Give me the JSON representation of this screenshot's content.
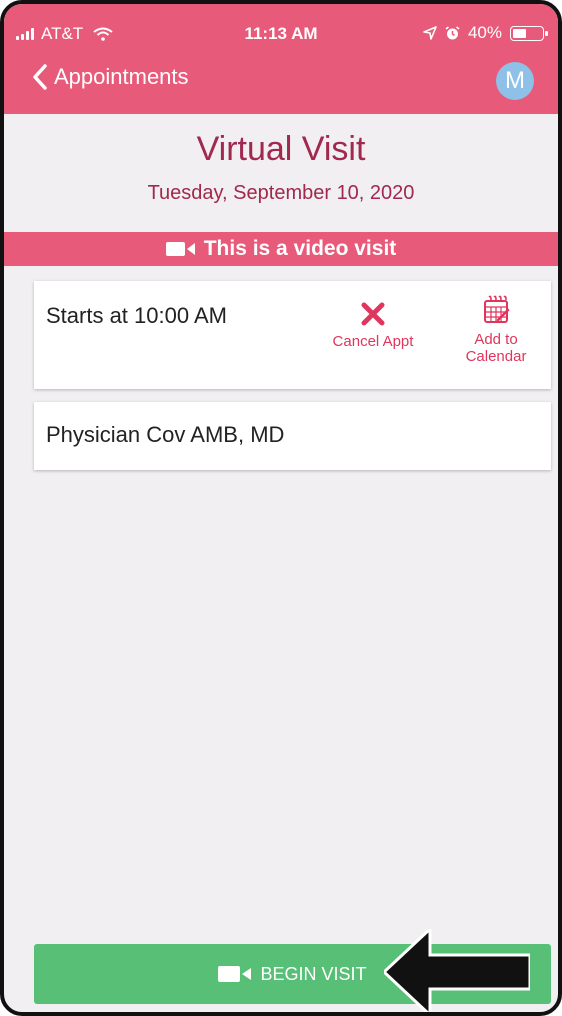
{
  "status_bar": {
    "carrier": "AT&T",
    "time": "11:13 AM",
    "battery": "40%",
    "battery_level": 0.4
  },
  "nav": {
    "back_label": "Appointments",
    "avatar_initial": "M"
  },
  "visit": {
    "title": "Virtual Visit",
    "date": "Tuesday, September 10, 2020",
    "video_banner": "This is a video visit",
    "start_time": "Starts at 10:00 AM",
    "physician": "Physician Cov AMB, MD"
  },
  "actions": {
    "cancel_label": "Cancel Appt",
    "calendar_label_line1": "Add to",
    "calendar_label_line2": "Calendar"
  },
  "begin_button": {
    "label": "BEGIN VISIT"
  },
  "colors": {
    "header": "#e85a7a",
    "title": "#a0294d",
    "accent": "#e0355d",
    "begin_button": "#57bf76",
    "background": "#f1eff1"
  },
  "icons": [
    "signal-icon",
    "wifi-icon",
    "location-icon",
    "alarm-icon",
    "battery-icon",
    "chevron-left-icon",
    "video-camera-icon",
    "close-x-icon",
    "calendar-icon",
    "arrow-annotation-icon"
  ]
}
